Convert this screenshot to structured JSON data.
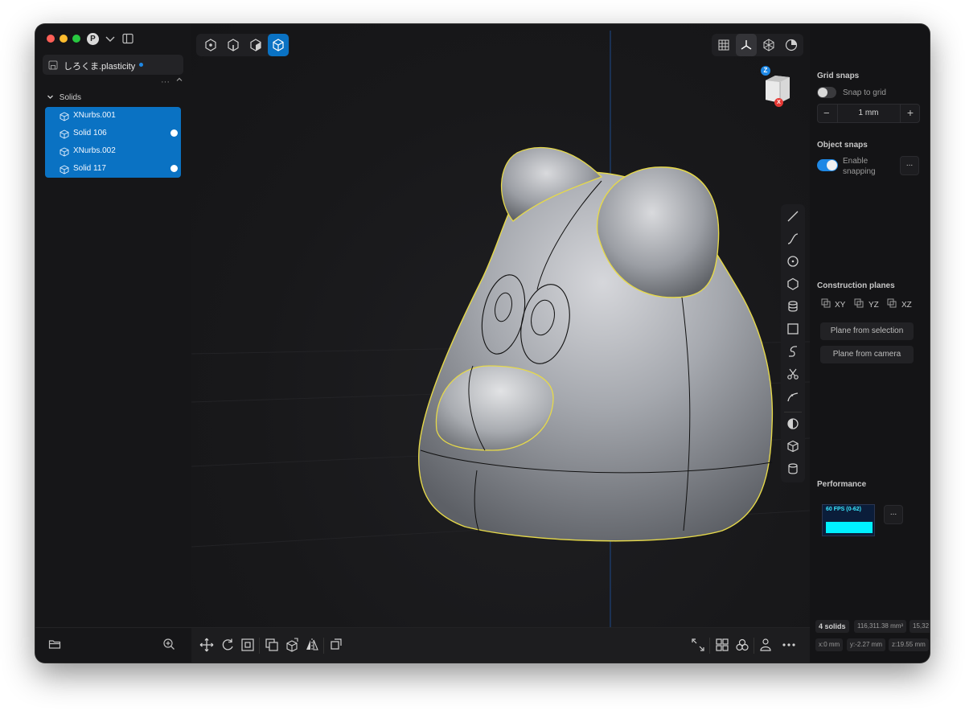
{
  "window": {
    "avatar_letter": "P",
    "colors": {
      "close": "#ff5f57",
      "minimize": "#febc2e",
      "zoom": "#28c840",
      "accent": "#0a72c3",
      "selection_outline": "#e6d94a"
    }
  },
  "file": {
    "name": "しろくま.plasticity",
    "unsaved_dot": true
  },
  "outliner": {
    "more_label": "···",
    "group_label": "Solids",
    "items": [
      {
        "label": "XNurbs.001",
        "visible_dot": false
      },
      {
        "label": "Solid 106",
        "visible_dot": true
      },
      {
        "label": "XNurbs.002",
        "visible_dot": false
      },
      {
        "label": "Solid 117",
        "visible_dot": true
      }
    ]
  },
  "viewport": {
    "top_toolbar_left": [
      "vertex-select-icon",
      "edge-select-icon",
      "face-select-icon",
      "solid-select-icon"
    ],
    "active_select_index": 3,
    "top_toolbar_right": [
      "grid-icon",
      "axes-icon",
      "wireframe-icon",
      "render-icon"
    ],
    "viewcube": {
      "axis_top": "Z",
      "axis_front": "X"
    },
    "side_tools": [
      "line-icon",
      "curve-icon",
      "circle-icon",
      "polygon-icon",
      "cylinder-stack-icon",
      "rectangle-icon",
      "spiral-icon",
      "scissors-icon",
      "trim-icon",
      "boolean-icon",
      "box-icon",
      "cylinder-icon"
    ],
    "bottom_left_tools": [
      "move-icon",
      "rotate-icon",
      "scale-icon",
      "duplicate-icon",
      "extrude-icon",
      "mirror-icon",
      "copy-icon"
    ],
    "bottom_right_tools": [
      "fit-icon",
      "grid-view-icon",
      "layers-icon",
      "person-icon",
      "more-icon"
    ]
  },
  "right_panel": {
    "grid_snaps_title": "Grid snaps",
    "snap_to_grid_label": "Snap to grid",
    "snap_to_grid_on": false,
    "grid_step": "1 mm",
    "minus_label": "−",
    "plus_label": "+",
    "object_snaps_title": "Object snaps",
    "enable_snapping_label1": "Enable",
    "enable_snapping_label2": "snapping",
    "enable_snapping_on": true,
    "more_label": "...",
    "construction_planes_title": "Construction planes",
    "planes": [
      "XY",
      "YZ",
      "XZ"
    ],
    "plane_from_selection": "Plane from selection",
    "plane_from_camera": "Plane from camera",
    "performance_title": "Performance",
    "fps_label": "60 FPS (0-62)"
  },
  "status": {
    "solids_count": "4 solids",
    "volume": "116,311.38 mm³",
    "extra": "15,32",
    "x": "x:0 mm",
    "y": "y:-2.27 mm",
    "z": "z:19.55 mm"
  }
}
